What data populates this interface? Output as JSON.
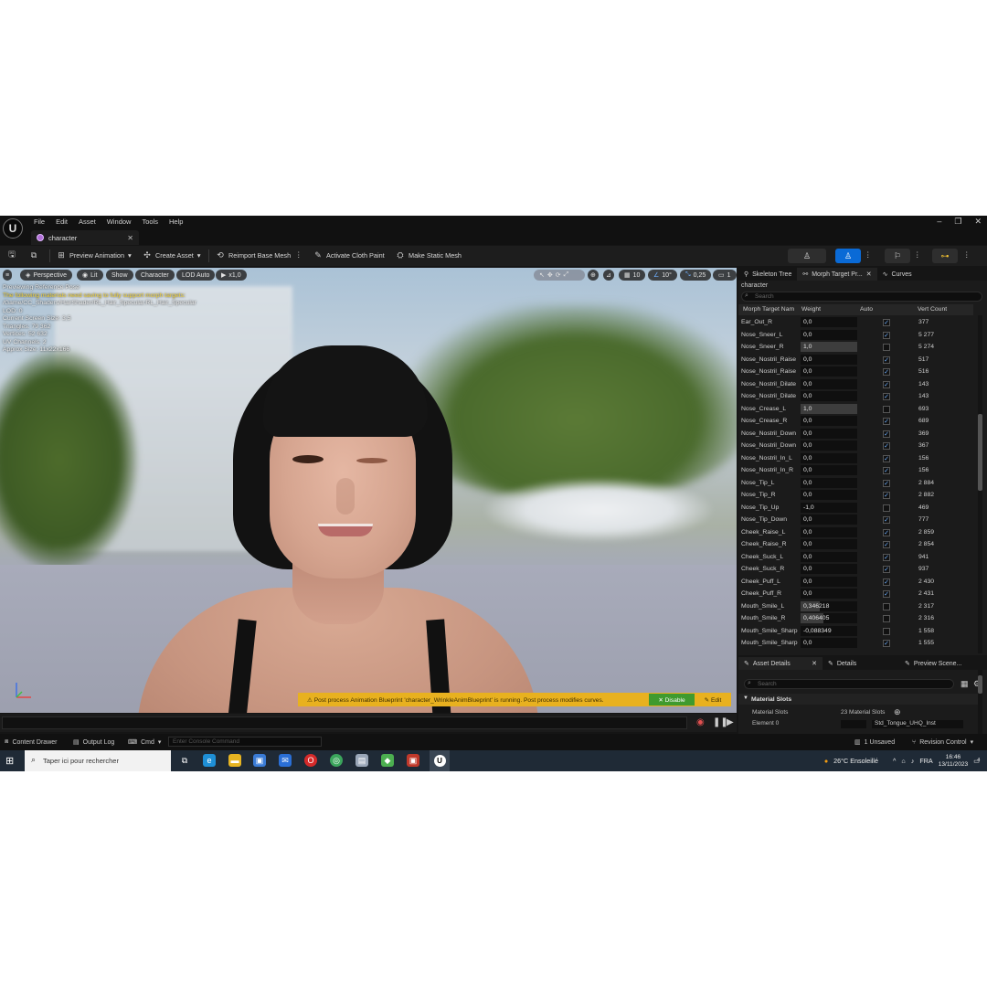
{
  "menu": [
    "File",
    "Edit",
    "Asset",
    "Window",
    "Tools",
    "Help"
  ],
  "tab": {
    "label": "character"
  },
  "toolbar": {
    "preview_animation": "Preview Animation",
    "create_asset": "Create Asset",
    "reimport": "Reimport Base Mesh",
    "cloth_paint": "Activate Cloth Paint",
    "static_mesh": "Make Static Mesh"
  },
  "viewport": {
    "perspective": "Perspective",
    "lit": "Lit",
    "show": "Show",
    "character": "Character",
    "lod": "LOD Auto",
    "speed": "x1,0",
    "grid": "10",
    "angle": "10°",
    "scale": "0,25",
    "cam": "1",
    "info_line1": "Previewing Reference Pose",
    "info_warn": "The following materials need saving to fully support morph targets:",
    "info_path": "/Game/CC_Shaders/HairShader/RL_Hair_Specular.RL_Hair_Specular",
    "info_lod": "LOD: 0",
    "info_screen": "Current Screen Size: 3,5",
    "info_tris": "Triangles: 79 362",
    "info_verts": "Vertices: 52 632",
    "info_uv": "UV Channels: 2",
    "info_size": "Approx Size: 11x22x166",
    "post_process_msg": "⚠ Post process Animation Blueprint 'character_WrinkleAnimBlueprint' is running. Post process modifies curves.",
    "disable": "✕ Disable",
    "edit": "✎ Edit"
  },
  "right_panel": {
    "tabs": [
      "Skeleton Tree",
      "Morph Target Pr...",
      "Curves"
    ],
    "asset": "character",
    "search_placeholder": "Search",
    "columns": [
      "Morph Target Nam",
      "Weight",
      "Auto",
      "Vert Count"
    ],
    "rows": [
      {
        "name": "Ear_Out_R",
        "weight": "0,0",
        "w": 0,
        "auto": true,
        "vc": "377"
      },
      {
        "name": "Nose_Sneer_L",
        "weight": "0,0",
        "w": 0,
        "auto": true,
        "vc": "5 277"
      },
      {
        "name": "Nose_Sneer_R",
        "weight": "1,0",
        "w": 1,
        "auto": false,
        "vc": "5 274"
      },
      {
        "name": "Nose_Nostril_Raise",
        "weight": "0,0",
        "w": 0,
        "auto": true,
        "vc": "517"
      },
      {
        "name": "Nose_Nostril_Raise",
        "weight": "0,0",
        "w": 0,
        "auto": true,
        "vc": "516"
      },
      {
        "name": "Nose_Nostril_Dilate",
        "weight": "0,0",
        "w": 0,
        "auto": true,
        "vc": "143"
      },
      {
        "name": "Nose_Nostril_Dilate",
        "weight": "0,0",
        "w": 0,
        "auto": true,
        "vc": "143"
      },
      {
        "name": "Nose_Crease_L",
        "weight": "1,0",
        "w": 1,
        "auto": false,
        "vc": "693"
      },
      {
        "name": "Nose_Crease_R",
        "weight": "0,0",
        "w": 0,
        "auto": true,
        "vc": "689"
      },
      {
        "name": "Nose_Nostril_Down",
        "weight": "0,0",
        "w": 0,
        "auto": true,
        "vc": "369"
      },
      {
        "name": "Nose_Nostril_Down",
        "weight": "0,0",
        "w": 0,
        "auto": true,
        "vc": "367"
      },
      {
        "name": "Nose_Nostril_In_L",
        "weight": "0,0",
        "w": 0,
        "auto": true,
        "vc": "156"
      },
      {
        "name": "Nose_Nostril_In_R",
        "weight": "0,0",
        "w": 0,
        "auto": true,
        "vc": "156"
      },
      {
        "name": "Nose_Tip_L",
        "weight": "0,0",
        "w": 0,
        "auto": true,
        "vc": "2 884"
      },
      {
        "name": "Nose_Tip_R",
        "weight": "0,0",
        "w": 0,
        "auto": true,
        "vc": "2 882"
      },
      {
        "name": "Nose_Tip_Up",
        "weight": "-1,0",
        "w": 0,
        "auto": false,
        "vc": "469"
      },
      {
        "name": "Nose_Tip_Down",
        "weight": "0,0",
        "w": 0,
        "auto": true,
        "vc": "777"
      },
      {
        "name": "Cheek_Raise_L",
        "weight": "0,0",
        "w": 0,
        "auto": true,
        "vc": "2 859"
      },
      {
        "name": "Cheek_Raise_R",
        "weight": "0,0",
        "w": 0,
        "auto": true,
        "vc": "2 854"
      },
      {
        "name": "Cheek_Suck_L",
        "weight": "0,0",
        "w": 0,
        "auto": true,
        "vc": "941"
      },
      {
        "name": "Cheek_Suck_R",
        "weight": "0,0",
        "w": 0,
        "auto": true,
        "vc": "937"
      },
      {
        "name": "Cheek_Puff_L",
        "weight": "0,0",
        "w": 0,
        "auto": true,
        "vc": "2 430"
      },
      {
        "name": "Cheek_Puff_R",
        "weight": "0,0",
        "w": 0,
        "auto": true,
        "vc": "2 431"
      },
      {
        "name": "Mouth_Smile_L",
        "weight": "0,346218",
        "w": 0.346218,
        "auto": false,
        "vc": "2 317"
      },
      {
        "name": "Mouth_Smile_R",
        "weight": "0,406405",
        "w": 0.406405,
        "auto": false,
        "vc": "2 316"
      },
      {
        "name": "Mouth_Smile_Sharp",
        "weight": "-0,088349",
        "w": 0,
        "auto": false,
        "vc": "1 558"
      },
      {
        "name": "Mouth_Smile_Sharp",
        "weight": "0,0",
        "w": 0,
        "auto": true,
        "vc": "1 555"
      }
    ]
  },
  "lower_panel": {
    "tabs": [
      "Asset Details",
      "Details",
      "Preview Scene..."
    ],
    "search_placeholder": "Search",
    "section": "Material Slots",
    "prop1_key": "Material Slots",
    "prop1_val": "23 Material Slots",
    "prop2_key": "Element 0",
    "prop2_val": "Std_Tongue_UHQ_Inst"
  },
  "statusbar": {
    "content_drawer": "Content Drawer",
    "output_log": "Output Log",
    "cmd": "Cmd",
    "console_placeholder": "Enter Console Command",
    "unsaved": "1 Unsaved",
    "revision": "Revision Control"
  },
  "taskbar": {
    "search": "Taper ici pour rechercher",
    "weather": "26°C Ensoleillé",
    "lang": "FRA",
    "time": "16:46",
    "date": "13/11/2023",
    "notif": "4"
  },
  "colors": {
    "accent": "#0a6ad6",
    "warning_bar": "#e8b11f",
    "disable_btn": "#3f9a2e"
  }
}
